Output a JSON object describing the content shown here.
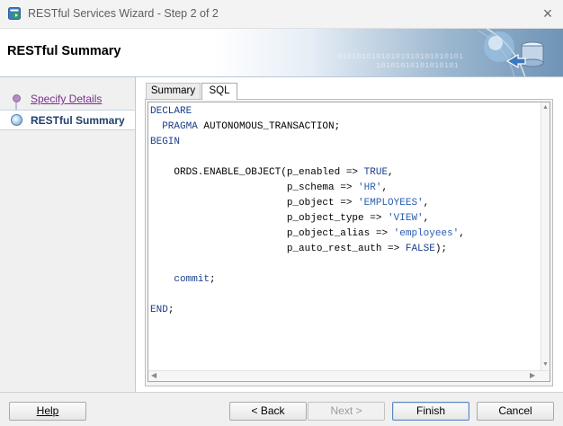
{
  "window": {
    "title": "RESTful Services Wizard - Step 2 of 2"
  },
  "header": {
    "title": "RESTful Summary",
    "binary_decoration": "01010101010101010101010101\n        10101010101010101"
  },
  "steps": [
    {
      "label": "Specify Details",
      "state": "visited"
    },
    {
      "label": "RESTful Summary",
      "state": "current"
    }
  ],
  "tabs": [
    {
      "label": "Summary",
      "selected": false
    },
    {
      "label": "SQL",
      "selected": true
    }
  ],
  "sql": {
    "lines": [
      [
        [
          "DECLARE",
          "kw"
        ]
      ],
      [
        [
          "  ",
          ""
        ],
        [
          "PRAGMA",
          "kw"
        ],
        [
          " AUTONOMOUS_TRANSACTION;",
          ""
        ]
      ],
      [
        [
          "BEGIN",
          "kw"
        ]
      ],
      [
        [
          "",
          ""
        ]
      ],
      [
        [
          "    ORDS.ENABLE_OBJECT(p_enabled => ",
          ""
        ],
        [
          "TRUE",
          "kw"
        ],
        [
          ",",
          ""
        ]
      ],
      [
        [
          "                       p_schema => ",
          ""
        ],
        [
          "'HR'",
          "str"
        ],
        [
          ",",
          ""
        ]
      ],
      [
        [
          "                       p_object => ",
          ""
        ],
        [
          "'EMPLOYEES'",
          "str"
        ],
        [
          ",",
          ""
        ]
      ],
      [
        [
          "                       p_object_type => ",
          ""
        ],
        [
          "'VIEW'",
          "str"
        ],
        [
          ",",
          ""
        ]
      ],
      [
        [
          "                       p_object_alias => ",
          ""
        ],
        [
          "'employees'",
          "str"
        ],
        [
          ",",
          ""
        ]
      ],
      [
        [
          "                       p_auto_rest_auth => ",
          ""
        ],
        [
          "FALSE",
          "kw"
        ],
        [
          ");",
          ""
        ]
      ],
      [
        [
          "",
          ""
        ]
      ],
      [
        [
          "    ",
          ""
        ],
        [
          "commit",
          "kw"
        ],
        [
          ";",
          ""
        ]
      ],
      [
        [
          "",
          ""
        ]
      ],
      [
        [
          "END",
          "kw"
        ],
        [
          ";",
          ""
        ]
      ]
    ]
  },
  "buttons": {
    "help": "Help",
    "back": "< Back",
    "next": "Next >",
    "finish": "Finish",
    "cancel": "Cancel"
  },
  "colors": {
    "keyword": "#1a3e8c",
    "string": "#2a5db0",
    "visited_link": "#7b2d8f",
    "current_step": "#1f3f6b"
  },
  "icons": {
    "app": "wizard-app-icon",
    "close": "close-icon",
    "header_graphic": "database-transfer-graphic"
  }
}
